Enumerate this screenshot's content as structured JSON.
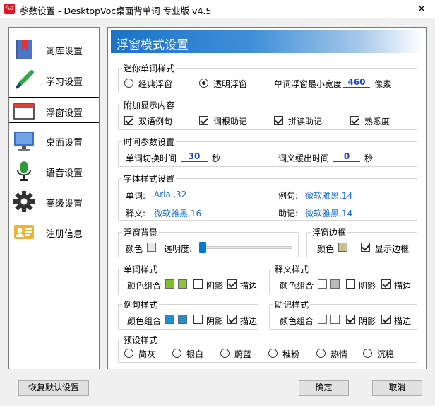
{
  "window": {
    "title": "参数设置 - DesktopVoc桌面背单词 专业版 v4.5",
    "app_icon_text": "Aa",
    "close_glyph": "✕"
  },
  "sidebar": {
    "items": [
      {
        "label": "词库设置",
        "icon": "book-icon"
      },
      {
        "label": "学习设置",
        "icon": "brush-icon"
      },
      {
        "label": "浮窗设置",
        "icon": "window-icon"
      },
      {
        "label": "桌面设置",
        "icon": "monitor-icon"
      },
      {
        "label": "语音设置",
        "icon": "microphone-icon"
      },
      {
        "label": "高级设置",
        "icon": "gear-icon"
      },
      {
        "label": "注册信息",
        "icon": "id-card-icon"
      }
    ],
    "active_index": 2
  },
  "main": {
    "title": "浮窗模式设置",
    "mini": {
      "title": "迷你单词样式",
      "opt1": "经典浮窗",
      "opt2": "透明浮窗",
      "selected": "透明浮窗",
      "width_label": "单词浮窗最小宽度",
      "width_value": "460",
      "width_unit": "像素"
    },
    "extra": {
      "title": "附加显示内容",
      "items": [
        {
          "label": "双语例句",
          "checked": true
        },
        {
          "label": "词根助记",
          "checked": true
        },
        {
          "label": "拼读助记",
          "checked": true
        },
        {
          "label": "熟悉度",
          "checked": true
        }
      ]
    },
    "time": {
      "title": "时间参数设置",
      "switch_label": "单词切换时间",
      "switch_value": "30",
      "switch_unit": "秒",
      "delay_label": "词义缓出时间",
      "delay_value": "0",
      "delay_unit": "秒"
    },
    "font": {
      "title": "字体样式设置",
      "word_label": "单词:",
      "word_value": "Arial,32",
      "example_label": "例句:",
      "example_value": "微软雅黑,14",
      "meaning_label": "释义:",
      "meaning_value": "微软雅黑,16",
      "mnemonic_label": "助记:",
      "mnemonic_value": "微软雅黑,14"
    },
    "bg": {
      "title": "浮窗背景",
      "color_label": "颜色",
      "color": "#e8e8e8",
      "opacity_label": "透明度:",
      "opacity_fraction": 0
    },
    "border": {
      "title": "浮窗边框",
      "color_label": "颜色",
      "color": "#c8c291",
      "show_label": "显示边框",
      "show_checked": true
    },
    "word_style": {
      "title": "单词样式",
      "combo_label": "颜色组合",
      "colors": [
        "#7fc02a",
        "#8cc63f"
      ],
      "shadow_label": "阴影",
      "shadow": false,
      "stroke_label": "描边",
      "stroke": true
    },
    "meaning_style": {
      "title": "释义样式",
      "combo_label": "颜色组合",
      "colors": [
        "#ffffff",
        "#b9b9b9"
      ],
      "shadow_label": "阴影",
      "shadow": false,
      "stroke_label": "描边",
      "stroke": true
    },
    "example_style": {
      "title": "例句样式",
      "combo_label": "颜色组合",
      "colors": [
        "#1e90d6",
        "#1e90d6"
      ],
      "shadow_label": "阴影",
      "shadow": false,
      "stroke_label": "描边",
      "stroke": true
    },
    "mnemonic_style": {
      "title": "助记样式",
      "combo_label": "颜色组合",
      "colors": [
        "#ffffff",
        "#ffffff"
      ],
      "shadow_label": "阴影",
      "shadow": true,
      "stroke_label": "描边",
      "stroke": true
    },
    "preset": {
      "title": "预设样式",
      "options": [
        "简灰",
        "银白",
        "蔚蓝",
        "稚粉",
        "热情",
        "沉稳"
      ]
    }
  },
  "buttons": {
    "reset": "恢复默认设置",
    "ok": "确定",
    "cancel": "取消"
  }
}
